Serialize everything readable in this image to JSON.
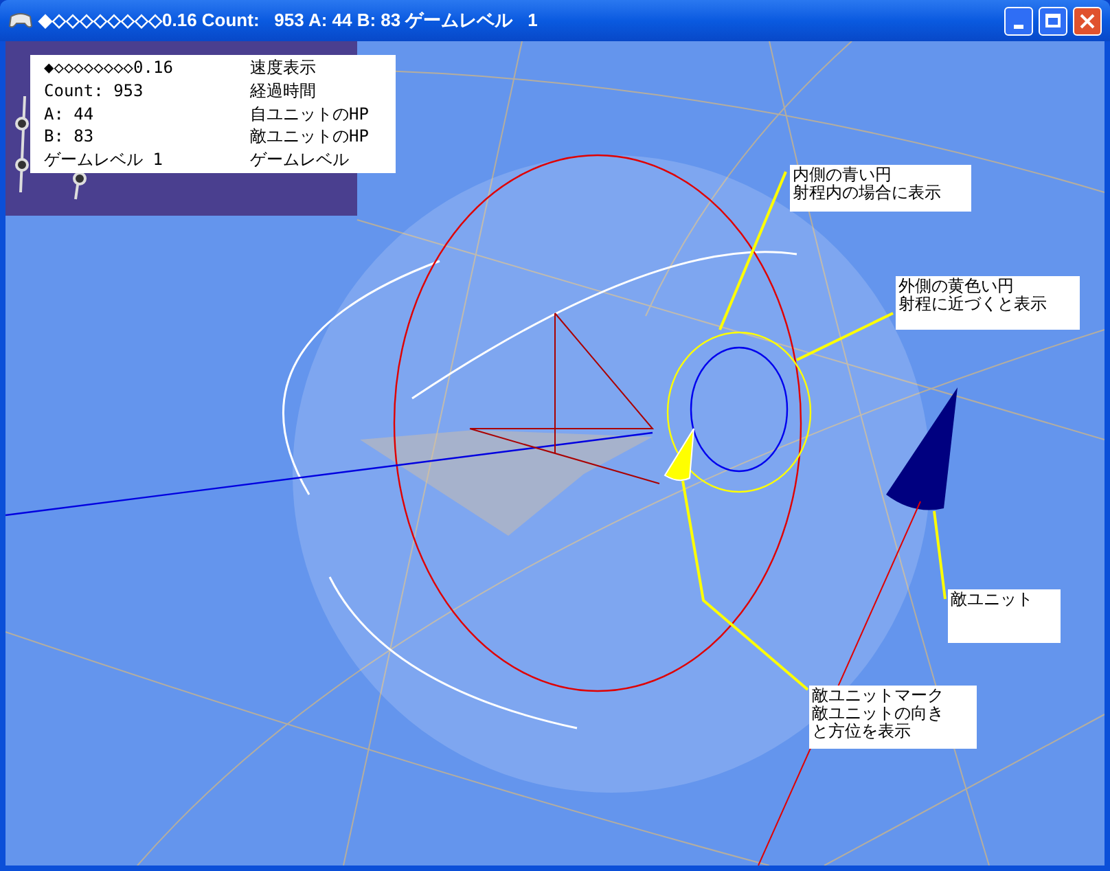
{
  "window": {
    "title": "◆◇◇◇◇◇◇◇◇0.16 Count:   953 A: 44 B: 83 ゲームレベル   1"
  },
  "hud": {
    "rows": [
      {
        "value": "◆◇◇◇◇◇◇◇◇0.16",
        "label": "速度表示"
      },
      {
        "value": "Count: 953",
        "label": "経過時間"
      },
      {
        "value": "A: 44",
        "label": "自ユニットのHP"
      },
      {
        "value": "B: 83",
        "label": "敵ユニットのHP"
      },
      {
        "value": "ゲームレベル 1",
        "label": "ゲームレベル"
      }
    ]
  },
  "callouts": [
    {
      "lines": [
        "内側の青い円",
        "射程内の場合に表示"
      ]
    },
    {
      "lines": [
        "外側の黄色い円",
        "射程に近づくと表示"
      ]
    },
    {
      "lines": [
        "敵ユニット"
      ]
    },
    {
      "lines": [
        "敵ユニットマーク",
        "敵ユニットの向き",
        "と方位を表示"
      ]
    }
  ]
}
